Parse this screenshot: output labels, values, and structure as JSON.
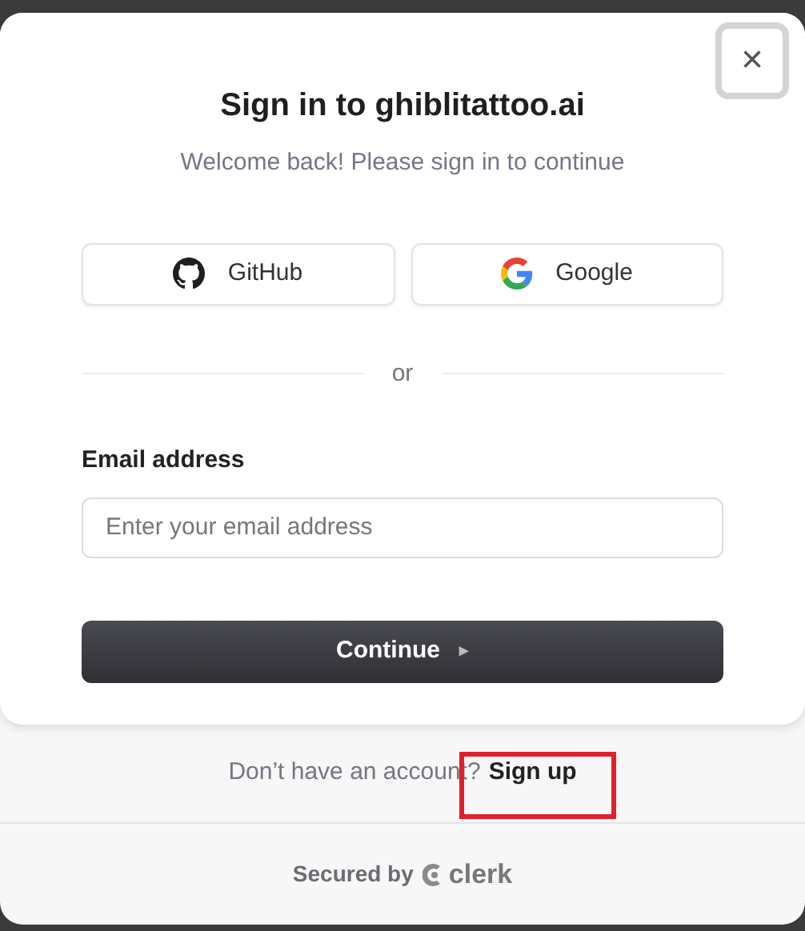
{
  "title": "Sign in to ghiblitattoo.ai",
  "subtitle": "Welcome back! Please sign in to continue",
  "social_buttons": [
    {
      "kind": "github",
      "label": "GitHub"
    },
    {
      "kind": "google",
      "label": "Google"
    }
  ],
  "divider": "or",
  "email": {
    "label": "Email address",
    "placeholder": "Enter your email address"
  },
  "continue_button": {
    "label": "Continue",
    "icon": "▸"
  },
  "close_button": {
    "icon": "×"
  },
  "footer": {
    "prompt": "Don’t have an account?",
    "link": "Sign up",
    "highlighted": true
  },
  "secured": {
    "text": "Secured by",
    "brand": "clerk"
  }
}
